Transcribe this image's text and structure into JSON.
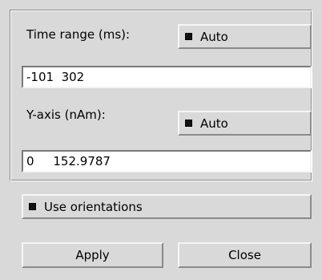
{
  "time_range": {
    "label": "Time range (ms):",
    "auto_label": "Auto",
    "auto_checked": true,
    "value": "-101  302"
  },
  "y_axis": {
    "label": "Y-axis (nAm):",
    "auto_label": "Auto",
    "auto_checked": true,
    "value": "0     152.9787"
  },
  "use_orientations": {
    "label": "Use orientations",
    "checked": true
  },
  "buttons": {
    "apply": "Apply",
    "close": "Close"
  },
  "colors": {
    "background": "#d9d9d9",
    "field_background": "#ffffff",
    "indicator": "#111111"
  }
}
